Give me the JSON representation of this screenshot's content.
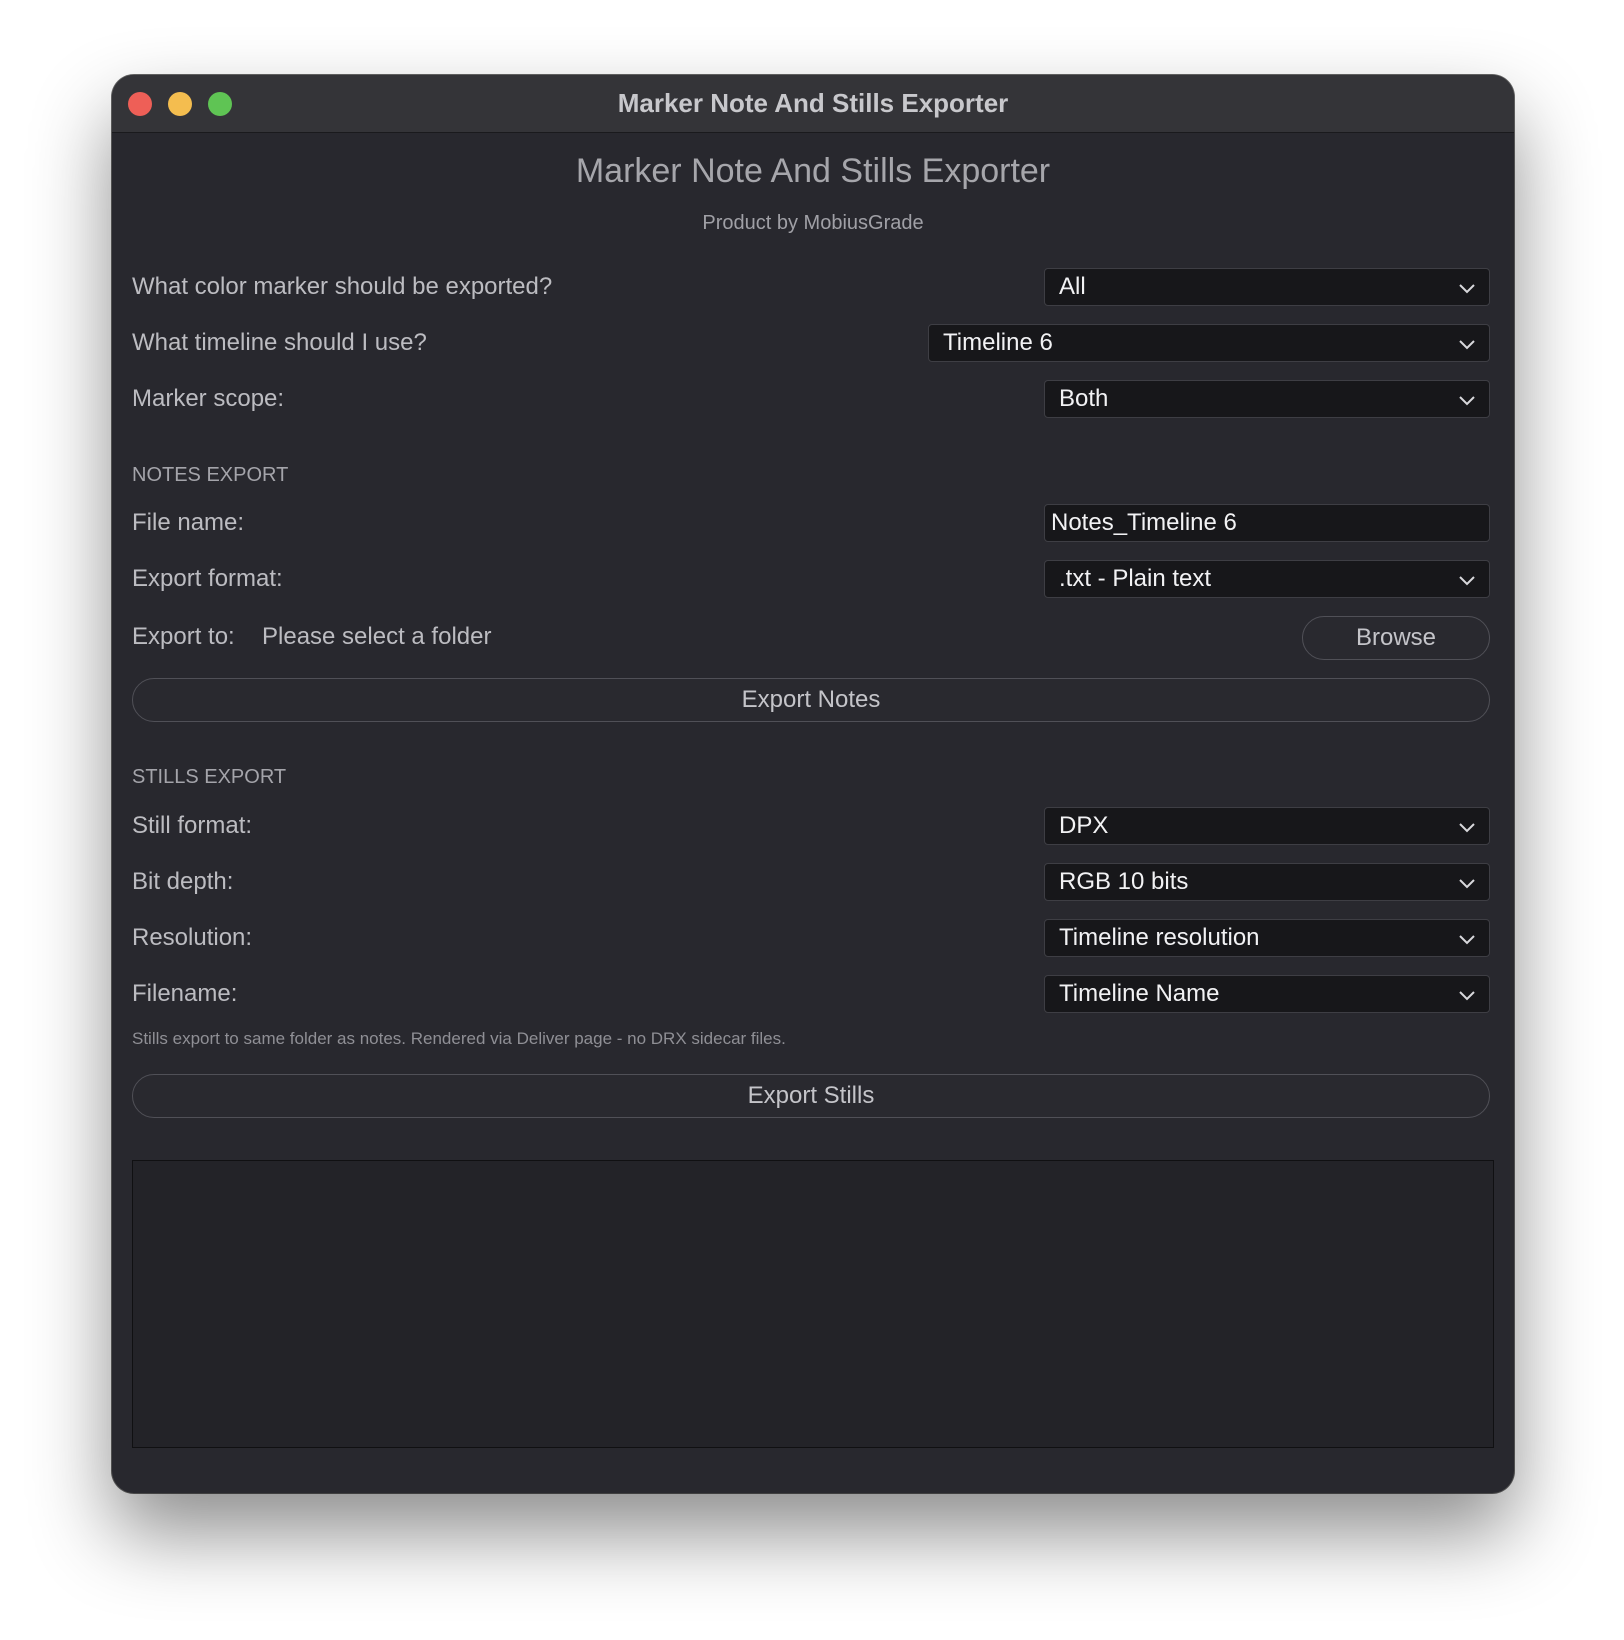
{
  "window": {
    "title": "Marker Note And Stills Exporter"
  },
  "header": {
    "title": "Marker Note And Stills Exporter",
    "subtitle": "Product by MobiusGrade"
  },
  "general": {
    "color_marker_label": "What color marker should be exported?",
    "color_marker_value": "All",
    "timeline_label": "What timeline should I use?",
    "timeline_value": "Timeline 6",
    "scope_label": "Marker scope:",
    "scope_value": "Both"
  },
  "notes_export": {
    "heading": "NOTES EXPORT",
    "file_name_label": "File name:",
    "file_name_value": "Notes_Timeline 6",
    "format_label": "Export format:",
    "format_value": ".txt - Plain text",
    "export_to_label": "Export to:",
    "export_to_value": "Please select a folder",
    "browse_label": "Browse",
    "export_button": "Export Notes"
  },
  "stills_export": {
    "heading": "STILLS EXPORT",
    "still_format_label": "Still format:",
    "still_format_value": "DPX",
    "bit_depth_label": "Bit depth:",
    "bit_depth_value": "RGB 10 bits",
    "resolution_label": "Resolution:",
    "resolution_value": "Timeline resolution",
    "filename_label": "Filename:",
    "filename_value": "Timeline Name",
    "hint": "Stills export to same folder as notes. Rendered via Deliver page - no DRX sidecar files.",
    "export_button": "Export Stills"
  },
  "icons": {
    "dropdown": "chevron-down-icon",
    "close": "close-window-icon",
    "minimize": "minimize-window-icon",
    "zoom": "zoom-window-icon"
  },
  "colors": {
    "window_bg": "#28282e",
    "field_bg": "#17171a",
    "traffic_red": "#ee5f57",
    "traffic_yellow": "#f4bd4f",
    "traffic_green": "#5fc454"
  }
}
